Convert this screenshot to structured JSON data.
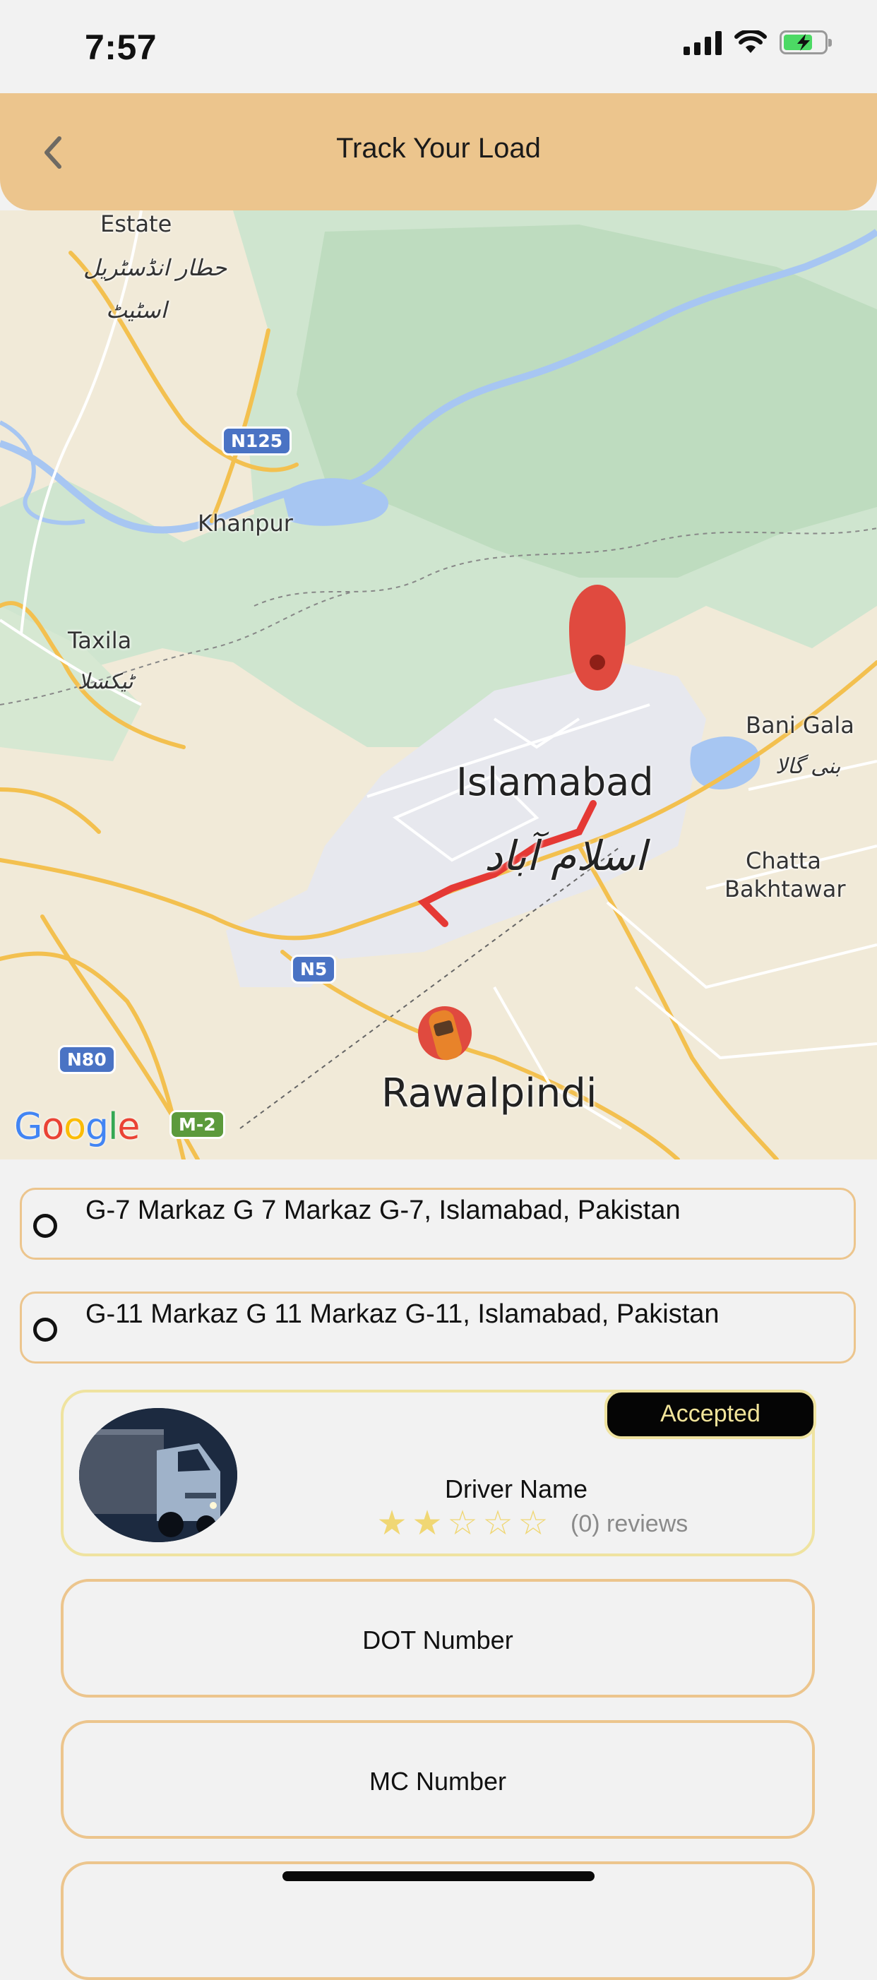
{
  "status_bar": {
    "time": "7:57"
  },
  "header": {
    "title": "Track Your Load"
  },
  "map": {
    "labels": {
      "estate": "Estate",
      "estate_urdu_1": "حطار انڈسٹریل",
      "estate_urdu_2": "اسٹیٹ",
      "khanpur": "Khanpur",
      "taxila": "Taxila",
      "taxila_urdu": "ٹیکسلا",
      "islamabad": "Islamabad",
      "islamabad_urdu": "اسلام آباد",
      "bani_gala": "Bani Gala",
      "bani_gala_urdu": "بنی گالا",
      "chatta_1": "Chatta",
      "chatta_2": "Bakhtawar",
      "rawalpindi": "Rawalpindi"
    },
    "shields": {
      "n125": "N125",
      "n5": "N5",
      "n80": "N80",
      "m2": "M-2"
    },
    "attribution": "Google"
  },
  "route": {
    "pickup": "G-7 Markaz G 7 Markaz G-7, Islamabad, Pakistan",
    "dropoff": "G-11 Markaz G 11 Markaz G-11, Islamabad, Pakistan"
  },
  "driver": {
    "status": "Accepted",
    "name": "Driver Name",
    "rating": 2,
    "max_rating": 5,
    "reviews": "(0) reviews"
  },
  "info": {
    "dot": "DOT Number",
    "mc": "MC Number"
  },
  "colors": {
    "header": "#ecc58d",
    "card_border": "#efe3a0",
    "badge_text": "#f1e49a",
    "route": "#e53935",
    "star": "#f0d774"
  }
}
